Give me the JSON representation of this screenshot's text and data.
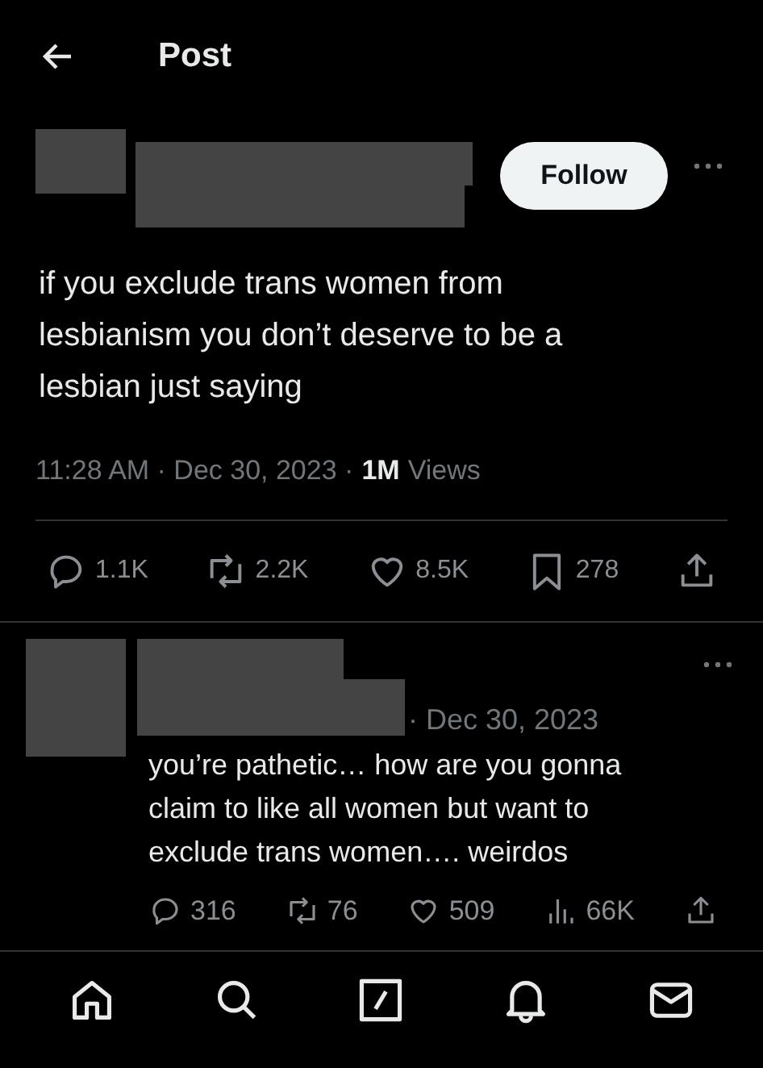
{
  "header": {
    "title": "Post"
  },
  "post": {
    "follow_label": "Follow",
    "text": "if you exclude trans women from lesbianism you don’t deserve to be a lesbian just saying",
    "time_date": "11:28 AM · Dec 30, 2023 ·",
    "views_count": "1M",
    "views_label": "Views",
    "actions": [
      {
        "kind": "reply",
        "count": "1.1K"
      },
      {
        "kind": "repost",
        "count": "2.2K"
      },
      {
        "kind": "like",
        "count": "8.5K"
      },
      {
        "kind": "bookmark",
        "count": "278"
      },
      {
        "kind": "share"
      }
    ]
  },
  "reply": {
    "date": "· Dec 30, 2023",
    "text": "you’re pathetic… how are you gonna claim to like all women but want to exclude trans women…. weirdos",
    "actions": [
      {
        "kind": "reply",
        "count": "316"
      },
      {
        "kind": "repost",
        "count": "76"
      },
      {
        "kind": "like",
        "count": "509"
      },
      {
        "kind": "views",
        "count": "66K"
      },
      {
        "kind": "share"
      }
    ]
  },
  "nav": [
    {
      "kind": "home"
    },
    {
      "kind": "search"
    },
    {
      "kind": "compose"
    },
    {
      "kind": "notifications"
    },
    {
      "kind": "messages"
    }
  ]
}
